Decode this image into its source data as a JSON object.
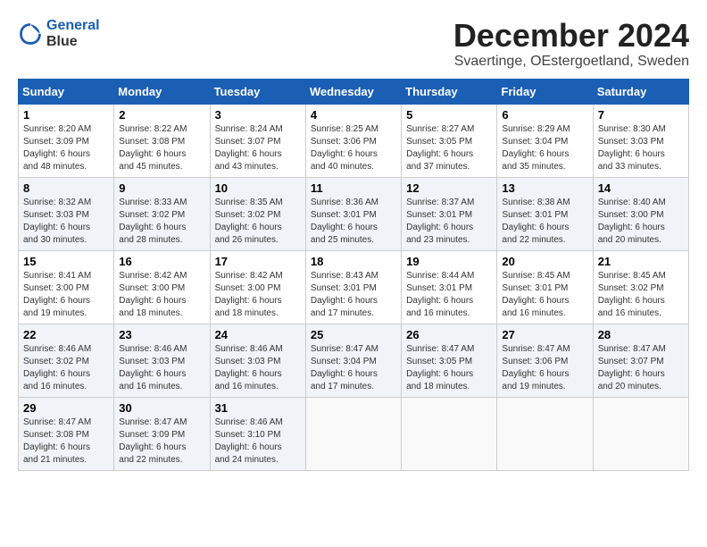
{
  "header": {
    "logo_line1": "General",
    "logo_line2": "Blue",
    "month_title": "December 2024",
    "location": "Svaertinge, OEstergoetland, Sweden"
  },
  "days_of_week": [
    "Sunday",
    "Monday",
    "Tuesday",
    "Wednesday",
    "Thursday",
    "Friday",
    "Saturday"
  ],
  "weeks": [
    [
      {
        "day": "1",
        "info": "Sunrise: 8:20 AM\nSunset: 3:09 PM\nDaylight: 6 hours\nand 48 minutes."
      },
      {
        "day": "2",
        "info": "Sunrise: 8:22 AM\nSunset: 3:08 PM\nDaylight: 6 hours\nand 45 minutes."
      },
      {
        "day": "3",
        "info": "Sunrise: 8:24 AM\nSunset: 3:07 PM\nDaylight: 6 hours\nand 43 minutes."
      },
      {
        "day": "4",
        "info": "Sunrise: 8:25 AM\nSunset: 3:06 PM\nDaylight: 6 hours\nand 40 minutes."
      },
      {
        "day": "5",
        "info": "Sunrise: 8:27 AM\nSunset: 3:05 PM\nDaylight: 6 hours\nand 37 minutes."
      },
      {
        "day": "6",
        "info": "Sunrise: 8:29 AM\nSunset: 3:04 PM\nDaylight: 6 hours\nand 35 minutes."
      },
      {
        "day": "7",
        "info": "Sunrise: 8:30 AM\nSunset: 3:03 PM\nDaylight: 6 hours\nand 33 minutes."
      }
    ],
    [
      {
        "day": "8",
        "info": "Sunrise: 8:32 AM\nSunset: 3:03 PM\nDaylight: 6 hours\nand 30 minutes."
      },
      {
        "day": "9",
        "info": "Sunrise: 8:33 AM\nSunset: 3:02 PM\nDaylight: 6 hours\nand 28 minutes."
      },
      {
        "day": "10",
        "info": "Sunrise: 8:35 AM\nSunset: 3:02 PM\nDaylight: 6 hours\nand 26 minutes."
      },
      {
        "day": "11",
        "info": "Sunrise: 8:36 AM\nSunset: 3:01 PM\nDaylight: 6 hours\nand 25 minutes."
      },
      {
        "day": "12",
        "info": "Sunrise: 8:37 AM\nSunset: 3:01 PM\nDaylight: 6 hours\nand 23 minutes."
      },
      {
        "day": "13",
        "info": "Sunrise: 8:38 AM\nSunset: 3:01 PM\nDaylight: 6 hours\nand 22 minutes."
      },
      {
        "day": "14",
        "info": "Sunrise: 8:40 AM\nSunset: 3:00 PM\nDaylight: 6 hours\nand 20 minutes."
      }
    ],
    [
      {
        "day": "15",
        "info": "Sunrise: 8:41 AM\nSunset: 3:00 PM\nDaylight: 6 hours\nand 19 minutes."
      },
      {
        "day": "16",
        "info": "Sunrise: 8:42 AM\nSunset: 3:00 PM\nDaylight: 6 hours\nand 18 minutes."
      },
      {
        "day": "17",
        "info": "Sunrise: 8:42 AM\nSunset: 3:00 PM\nDaylight: 6 hours\nand 18 minutes."
      },
      {
        "day": "18",
        "info": "Sunrise: 8:43 AM\nSunset: 3:01 PM\nDaylight: 6 hours\nand 17 minutes."
      },
      {
        "day": "19",
        "info": "Sunrise: 8:44 AM\nSunset: 3:01 PM\nDaylight: 6 hours\nand 16 minutes."
      },
      {
        "day": "20",
        "info": "Sunrise: 8:45 AM\nSunset: 3:01 PM\nDaylight: 6 hours\nand 16 minutes."
      },
      {
        "day": "21",
        "info": "Sunrise: 8:45 AM\nSunset: 3:02 PM\nDaylight: 6 hours\nand 16 minutes."
      }
    ],
    [
      {
        "day": "22",
        "info": "Sunrise: 8:46 AM\nSunset: 3:02 PM\nDaylight: 6 hours\nand 16 minutes."
      },
      {
        "day": "23",
        "info": "Sunrise: 8:46 AM\nSunset: 3:03 PM\nDaylight: 6 hours\nand 16 minutes."
      },
      {
        "day": "24",
        "info": "Sunrise: 8:46 AM\nSunset: 3:03 PM\nDaylight: 6 hours\nand 16 minutes."
      },
      {
        "day": "25",
        "info": "Sunrise: 8:47 AM\nSunset: 3:04 PM\nDaylight: 6 hours\nand 17 minutes."
      },
      {
        "day": "26",
        "info": "Sunrise: 8:47 AM\nSunset: 3:05 PM\nDaylight: 6 hours\nand 18 minutes."
      },
      {
        "day": "27",
        "info": "Sunrise: 8:47 AM\nSunset: 3:06 PM\nDaylight: 6 hours\nand 19 minutes."
      },
      {
        "day": "28",
        "info": "Sunrise: 8:47 AM\nSunset: 3:07 PM\nDaylight: 6 hours\nand 20 minutes."
      }
    ],
    [
      {
        "day": "29",
        "info": "Sunrise: 8:47 AM\nSunset: 3:08 PM\nDaylight: 6 hours\nand 21 minutes."
      },
      {
        "day": "30",
        "info": "Sunrise: 8:47 AM\nSunset: 3:09 PM\nDaylight: 6 hours\nand 22 minutes."
      },
      {
        "day": "31",
        "info": "Sunrise: 8:46 AM\nSunset: 3:10 PM\nDaylight: 6 hours\nand 24 minutes."
      },
      {
        "day": "",
        "info": ""
      },
      {
        "day": "",
        "info": ""
      },
      {
        "day": "",
        "info": ""
      },
      {
        "day": "",
        "info": ""
      }
    ]
  ]
}
